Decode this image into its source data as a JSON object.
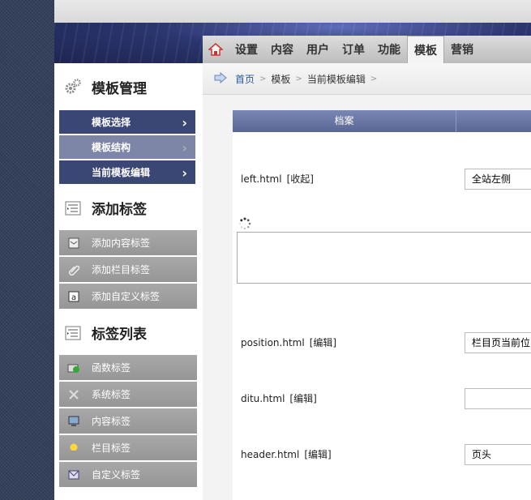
{
  "nav": {
    "items": [
      {
        "label": "设置"
      },
      {
        "label": "内容"
      },
      {
        "label": "用户"
      },
      {
        "label": "订单"
      },
      {
        "label": "功能"
      },
      {
        "label": "模板"
      },
      {
        "label": "营销"
      }
    ],
    "active": "模板"
  },
  "breadcrumb": {
    "home": "首页",
    "level1": "模板",
    "level2": "当前模板编辑"
  },
  "sidebar": {
    "section1": {
      "title": "模板管理",
      "items": [
        {
          "label": "模板选择"
        },
        {
          "label": "模板结构"
        },
        {
          "label": "当前模板编辑"
        }
      ]
    },
    "section2": {
      "title": "添加标签",
      "items": [
        {
          "label": "添加内容标签"
        },
        {
          "label": "添加栏目标签"
        },
        {
          "label": "添加自定义标签"
        }
      ]
    },
    "section3": {
      "title": "标签列表",
      "items": [
        {
          "label": "函数标签"
        },
        {
          "label": "系统标签"
        },
        {
          "label": "内容标签"
        },
        {
          "label": "栏目标签"
        },
        {
          "label": "自定义标签"
        }
      ]
    }
  },
  "table": {
    "header": "档案"
  },
  "files": [
    {
      "name": "left.html",
      "action": "[收起]",
      "value": "全站左侧"
    },
    {
      "name": "position.html",
      "action": "[编辑]",
      "value": "栏目页当前位"
    },
    {
      "name": "ditu.html",
      "action": "[编辑]",
      "value": ""
    },
    {
      "name": "header.html",
      "action": "[编辑]",
      "value": "页头"
    }
  ]
}
